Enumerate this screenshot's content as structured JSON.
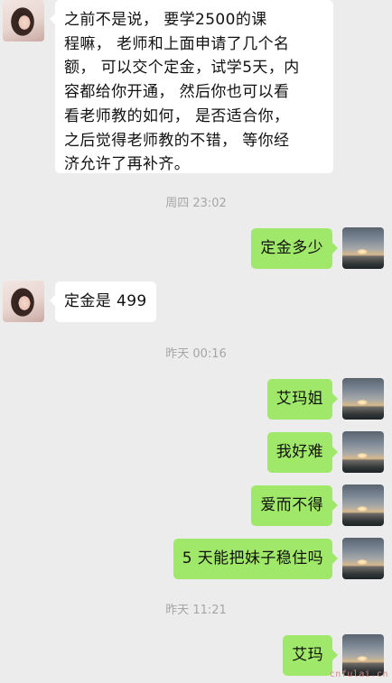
{
  "messages": [
    {
      "side": "left",
      "lines": [
        "之前不是说，     要学2500的课",
        "程嘛， 老师和上面申请了几个名",
        "额， 可以交个定金，试学5天，内",
        "容都给你开通， 然后你也可以看",
        "看老师教的如何， 是否适合你，",
        "之后觉得老师教的不错， 等你经",
        "济允许了再补齐。"
      ]
    },
    {
      "timestamp": "周四 23:02"
    },
    {
      "side": "right",
      "text": "定金多少"
    },
    {
      "side": "left",
      "text": "定金是 499"
    },
    {
      "timestamp": "昨天 00:16"
    },
    {
      "side": "right",
      "text": "艾玛姐"
    },
    {
      "side": "right",
      "text": "我好难"
    },
    {
      "side": "right",
      "text": "爱而不得"
    },
    {
      "side": "right",
      "text": "5 天能把妹子稳住吗"
    },
    {
      "timestamp": "昨天 11:21"
    },
    {
      "side": "right",
      "text": "艾玛"
    }
  ],
  "avatars": {
    "contact": "woman-portrait",
    "self": "sunset-sky"
  },
  "watermark": "cnfulai.cn"
}
